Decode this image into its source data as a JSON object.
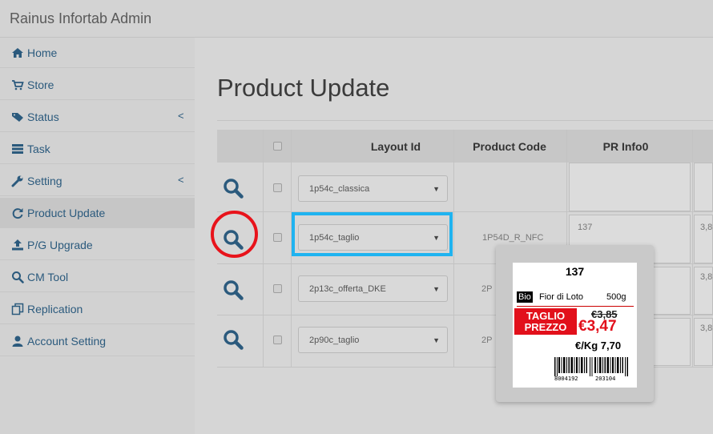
{
  "app": {
    "title": "Rainus Infortab Admin"
  },
  "sidebar": {
    "items": [
      {
        "label": "Home",
        "icon": "home-icon"
      },
      {
        "label": "Store",
        "icon": "cart-icon"
      },
      {
        "label": "Status",
        "icon": "tag-icon",
        "chevron": "<"
      },
      {
        "label": "Task",
        "icon": "list-icon"
      },
      {
        "label": "Setting",
        "icon": "wrench-icon",
        "chevron": "<"
      },
      {
        "label": "Product Update",
        "icon": "refresh-icon",
        "active": true
      },
      {
        "label": "P/G Upgrade",
        "icon": "upload-icon"
      },
      {
        "label": "CM Tool",
        "icon": "search-icon"
      },
      {
        "label": "Replication",
        "icon": "copy-icon"
      },
      {
        "label": "Account Setting",
        "icon": "user-icon"
      }
    ]
  },
  "main": {
    "title": "Product Update",
    "table": {
      "headers": [
        "Layout Id",
        "Product Code",
        "PR Info0"
      ],
      "rows": [
        {
          "layout": "1p54c_classica",
          "product_code": "",
          "pr_info0": "",
          "next": ""
        },
        {
          "layout": "1p54c_taglio",
          "product_code": "1P54D_R_NFC",
          "pr_info0": "137",
          "next": "3,8"
        },
        {
          "layout": "2p13c_offerta_DKE",
          "product_code": "2P",
          "pr_info0": "",
          "next": "3,8"
        },
        {
          "layout": "2p90c_taglio",
          "product_code": "2P",
          "pr_info0": "",
          "next": "3,8"
        }
      ],
      "caret": "▼"
    }
  },
  "preview": {
    "code": "137",
    "bio": "Bio",
    "name": "Fior di Loto",
    "weight": "500g",
    "promo_line1": "TAGLIO",
    "promo_line2": "PREZZO",
    "old_price": "€3,85",
    "new_price": "€3,47",
    "per_kg": "€/Kg 7,70",
    "barcode_left": "8004192",
    "barcode_right": "203104"
  },
  "colors": {
    "highlight_circle": "#e8131b",
    "highlight_rect": "#1fb3f0",
    "icon_blue": "#2b5a7d",
    "promo_red": "#e2101b"
  }
}
